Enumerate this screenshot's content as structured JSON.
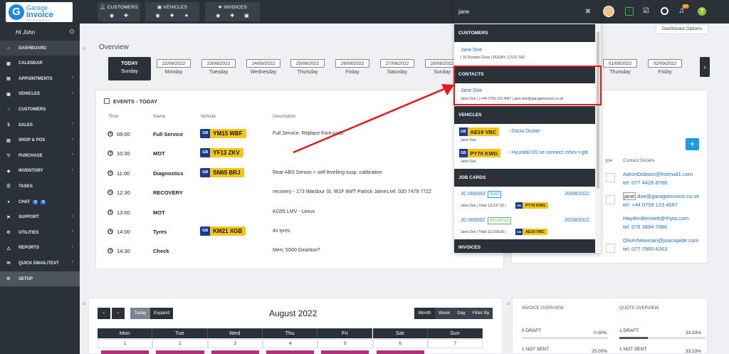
{
  "brand": {
    "line1": "Garage",
    "line2": "Invoice",
    "tagline": "www.garageinvoice.co.uk"
  },
  "topnav": [
    {
      "label": "CUSTOMERS"
    },
    {
      "label": "VEHICLES"
    },
    {
      "label": "INVOICES"
    }
  ],
  "user": {
    "greeting": "Hi John",
    "notifications": "10"
  },
  "sidebar": [
    {
      "label": "DASHBOARD",
      "icon": "home-icon",
      "chevron": false
    },
    {
      "label": "CALENDAR",
      "icon": "calendar-icon",
      "chevron": false
    },
    {
      "label": "APPOINTMENTS",
      "icon": "appointments-icon",
      "chevron": true
    },
    {
      "label": "VEHICLES",
      "icon": "car-icon",
      "chevron": true
    },
    {
      "label": "CUSTOMERS",
      "icon": "user-icon",
      "chevron": false
    },
    {
      "label": "SALES",
      "icon": "dollar-icon",
      "chevron": true
    },
    {
      "label": "SHOP & POS",
      "icon": "shop-icon",
      "chevron": true
    },
    {
      "label": "PURCHASE",
      "icon": "cart-icon",
      "chevron": true
    },
    {
      "label": "INVENTORY",
      "icon": "box-icon",
      "chevron": true
    },
    {
      "label": "TASKS",
      "icon": "tasks-icon",
      "chevron": false
    },
    {
      "label": "CHAT",
      "icon": "chat-icon",
      "chevron": false,
      "badges": [
        "0",
        "0"
      ]
    },
    {
      "label": "SUPPORT",
      "icon": "support-icon",
      "chevron": true
    },
    {
      "label": "UTILITIES",
      "icon": "cogs-icon",
      "chevron": true
    },
    {
      "label": "REPORTS",
      "icon": "reports-icon",
      "chevron": true
    },
    {
      "label": "QUICK EMAIL/TEXT",
      "icon": "envelope-icon",
      "chevron": true
    },
    {
      "label": "SETUP",
      "icon": "gear-icon",
      "chevron": false
    }
  ],
  "overview": {
    "title": "Overview",
    "dashboard_options": "Dashboard Options",
    "today": {
      "label": "TODAY",
      "day": "Sunday"
    },
    "days": [
      {
        "date": "22/08/2022",
        "day": "Monday"
      },
      {
        "date": "23/08/2022",
        "day": "Tuesday"
      },
      {
        "date": "24/08/2022",
        "day": "Wednesday"
      },
      {
        "date": "25/08/2022",
        "day": "Thursday"
      },
      {
        "date": "26/08/2022",
        "day": "Friday"
      },
      {
        "date": "27/08/2022",
        "day": "Saturday"
      },
      {
        "date": "28/08/2022",
        "day": "Sunday"
      },
      {
        "date": "01/09/2022",
        "day": "Thursday"
      },
      {
        "date": "02/09/2022",
        "day": "Friday"
      }
    ]
  },
  "events": {
    "title": "EVENTS - TODAY",
    "columns": [
      "Time",
      "Name",
      "Vehicle",
      "Description"
    ],
    "rows": [
      {
        "time": "09:00",
        "name": "Full Service",
        "plate": "YM15 WBF",
        "desc": "Full Service. Replace front pads"
      },
      {
        "time": "10:30",
        "name": "MOT",
        "plate": "YF13 ZKV",
        "desc": ""
      },
      {
        "time": "11:00",
        "name": "Diagnostics",
        "plate": "SN65 BRJ",
        "desc": "Rear ABS Sensor + self levelling susp. calibration"
      },
      {
        "time": "12:30",
        "name": "RECOVERY",
        "plate": "",
        "desc": "recovery - 173 Wardour St, W1F 8WT Patrick James tel. 020 7479 7722"
      },
      {
        "time": "13:00",
        "name": "MOT",
        "plate": "",
        "desc": "KG55 LMV - Lexus"
      },
      {
        "time": "14:00",
        "name": "Tyres",
        "plate": "KM21 XGB",
        "desc": "4x tyres"
      },
      {
        "time": "14:30",
        "name": "Check",
        "plate": "",
        "desc": "Merc S500 Gearbox?"
      }
    ],
    "plate_prefix": "GB"
  },
  "contacts_panel": {
    "col_type": "ype",
    "col_details": "Contact Details",
    "rows": [
      {
        "email": "AaronDobson@hotmail1.com",
        "tel": "tel: 077 4426 8786"
      },
      {
        "email_prefix": "jane",
        "email": ".doe@garageinvoice.co.uk",
        "tel": "tel: +44 0759 123 4567"
      },
      {
        "email": "HaydenBennett@rhyta.com",
        "tel": "tel: 078 3894 7086"
      },
      {
        "email": "OliverNewman@jourrapide.com",
        "tel": "tel: 077 7960 6283"
      }
    ]
  },
  "calendar": {
    "buttons": {
      "today": "Today",
      "expand": "Expand",
      "month": "Month",
      "week": "Week",
      "day": "Day",
      "filter": "Filter By"
    },
    "title": "August 2022",
    "weekdays": [
      "Mon",
      "Tue",
      "Wed",
      "Thu",
      "Fri",
      "Sat",
      "Sun"
    ],
    "dates": [
      "1",
      "2",
      "3",
      "4",
      "5",
      "6",
      "7"
    ]
  },
  "invoice_overview": {
    "title": "INVOICE OVERVIEW",
    "draft_label": "0 DRAFT",
    "draft_pct": "0.00%",
    "not_sent_label": "1 NOT SENT",
    "not_sent_pct": "25.00%"
  },
  "quote_overview": {
    "title": "QUOTE OVERVIEW",
    "draft_label": "1 DRAFT",
    "draft_pct": "33.33%",
    "not_sent_label": "1 NOT SENT",
    "not_sent_pct": "33.33%"
  },
  "search": {
    "query": "jane",
    "sections": {
      "customers": "CUSTOMERS",
      "contacts": "CONTACTS",
      "vehicles": "VEHICLES",
      "jobcards": "JOB CARDS",
      "invoices": "INVOICES"
    },
    "customer": {
      "name": "Jane Doe",
      "address": "| 10 Dunster Close | RUGBY | CV22 7AZ"
    },
    "contact": {
      "name": "Jane Doe",
      "details": "Jane Doe | | +44 0759 123 4567 | jane.doe@garageinvoice.co.uk"
    },
    "vehicles": [
      {
        "plate": "AE19 VBC",
        "model": "- Dacia Duster",
        "owner": "Jane Doe"
      },
      {
        "plate": "PY70 KWG",
        "model": "- Hyundai I20 se connect mhev t-gdi",
        "owner": "Jane Doe"
      }
    ],
    "jobcards": [
      {
        "id": "JC-000003",
        "status": "SENT",
        "date": "20/08/2022",
        "summary": "Jane Doe | Total: £3,237.60 |",
        "plate": "PY70 KWG"
      },
      {
        "id": "JC-000002",
        "status": "ACCEPTED",
        "date": "20/08/2022",
        "summary": "Jane Doe | Total: £1,518.00 |",
        "plate": "AE19 VBC"
      }
    ]
  },
  "colors": {
    "sidebar": "#2b3138",
    "accent": "#1e9be6",
    "plate": "#f5c518",
    "highlight": "#e8171e",
    "arrow": "#e8171e"
  }
}
